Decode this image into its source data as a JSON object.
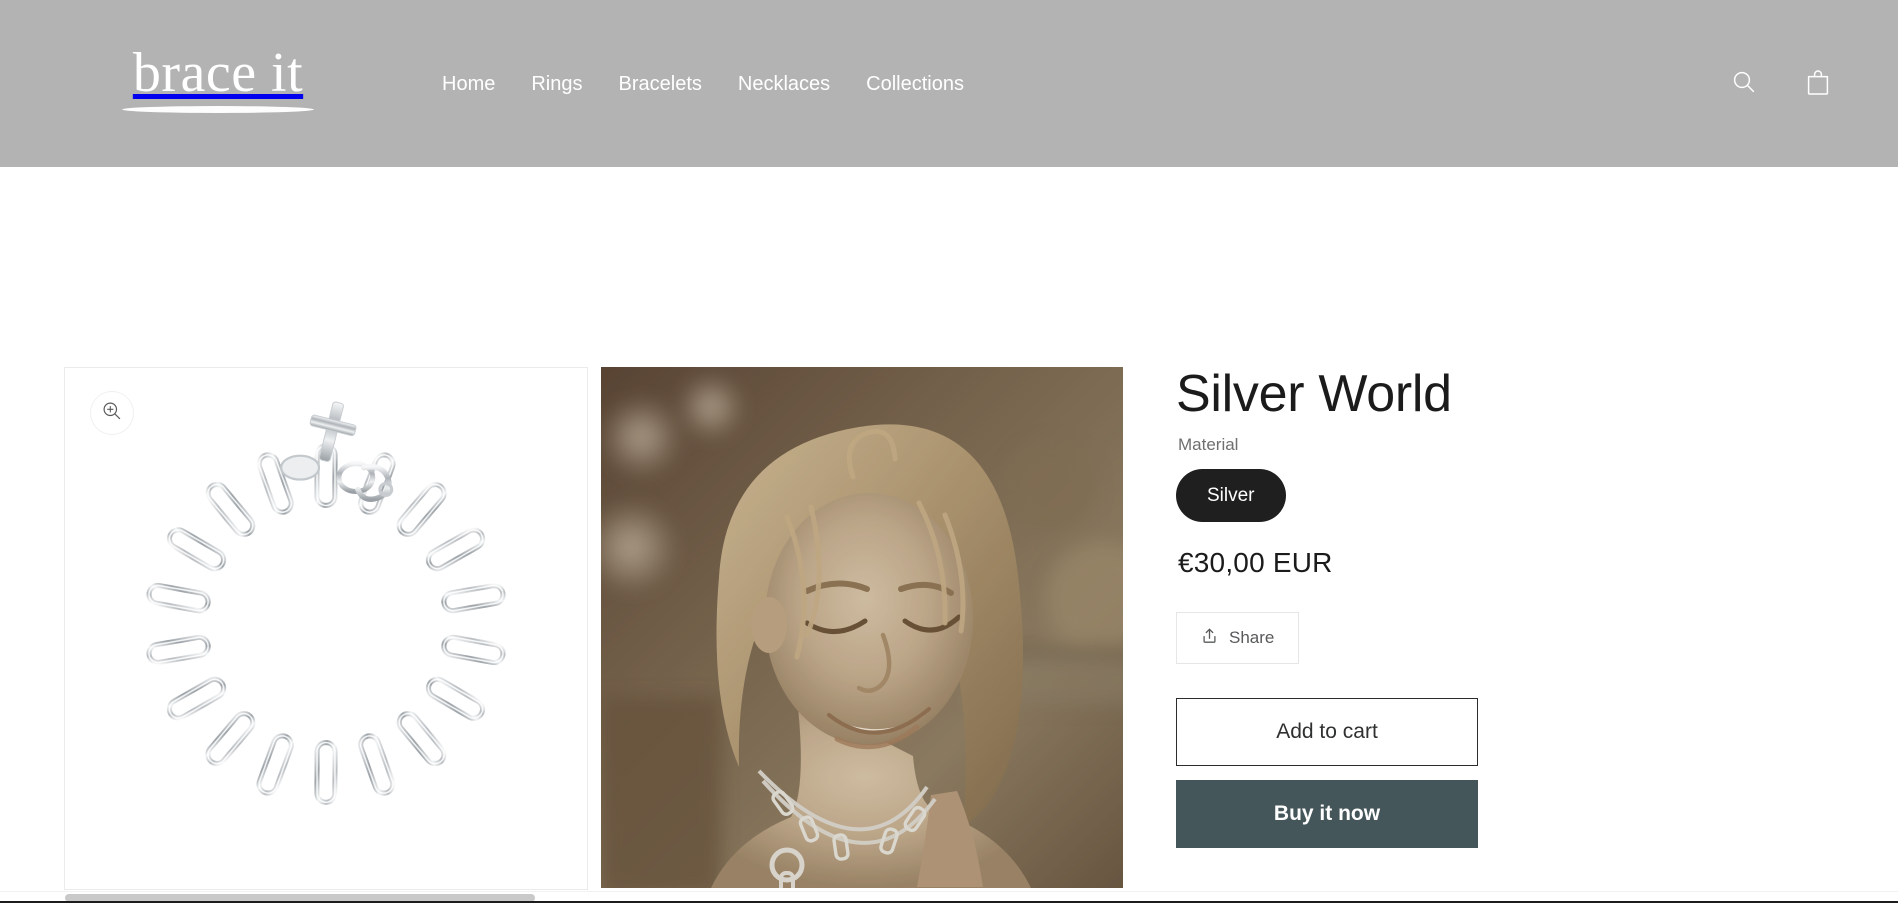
{
  "header": {
    "logo_text": "brace it",
    "logo_icon": "brace-it-wordmark",
    "background_color": "#b3b3b3",
    "nav": [
      {
        "label": "Home"
      },
      {
        "label": "Rings"
      },
      {
        "label": "Bracelets"
      },
      {
        "label": "Necklaces"
      },
      {
        "label": "Collections"
      }
    ],
    "actions": [
      {
        "icon": "search-icon",
        "label": "Search"
      },
      {
        "icon": "cart-icon",
        "label": "Cart"
      }
    ]
  },
  "gallery": {
    "zoom_icon": "zoom-in-icon",
    "images": [
      {
        "alt": "Silver paperclip chain bracelet with cross charm",
        "type": "product-photo"
      },
      {
        "alt": "Model wearing silver paperclip chain necklace outdoors",
        "type": "lifestyle-photo"
      }
    ]
  },
  "product": {
    "title": "Silver World",
    "option_label": "Material",
    "variants": [
      {
        "label": "Silver",
        "selected": true
      }
    ],
    "price": "€30,00 EUR",
    "share_label": "Share",
    "share_icon": "share-icon",
    "add_to_cart_label": "Add to cart",
    "buy_now_label": "Buy it now"
  },
  "colors": {
    "header_gray": "#b3b3b3",
    "variant_pill": "#1f1f1f",
    "buy_now": "#45565a",
    "text_primary": "#1c1b1b",
    "text_muted": "#6f6f6f"
  }
}
